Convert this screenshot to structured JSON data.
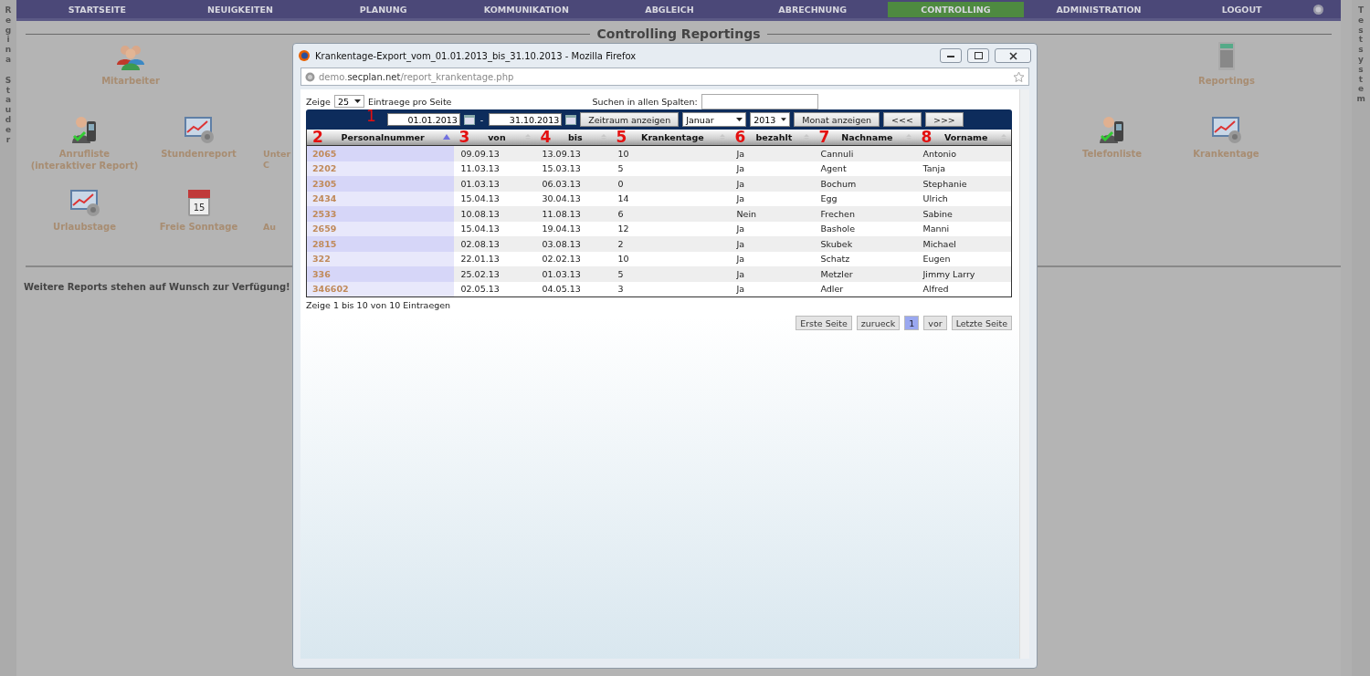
{
  "top_nav": {
    "items": [
      {
        "label": "STARTSEITE",
        "selected": false
      },
      {
        "label": "NEUIGKEITEN",
        "selected": false
      },
      {
        "label": "PLANUNG",
        "selected": false
      },
      {
        "label": "KOMMUNIKATION",
        "selected": false
      },
      {
        "label": "ABGLEICH",
        "selected": false
      },
      {
        "label": "ABRECHNUNG",
        "selected": false
      },
      {
        "label": "CONTROLLING",
        "selected": true
      },
      {
        "label": "ADMINISTRATION",
        "selected": false
      },
      {
        "label": "LOGOUT",
        "selected": false
      }
    ]
  },
  "user_name_lines": [
    "Regina",
    "Stauder"
  ],
  "system_label": "Testsystem",
  "page_title": "Controlling Reportings",
  "tile_rows": [
    [
      {
        "kind": "people",
        "label": "Mitarbeiter"
      },
      {
        "kind": "none"
      },
      {
        "kind": "none"
      },
      {
        "kind": "none"
      },
      {
        "kind": "none"
      },
      {
        "kind": "calculator",
        "label": "Reportings"
      }
    ],
    [
      {
        "kind": "phone",
        "label": "Anrufliste\n(interaktiver Report)"
      },
      {
        "kind": "chart",
        "label": "Stundenreport"
      },
      {
        "kind": "partial",
        "label": "Unter\nC"
      },
      {
        "kind": "none"
      },
      {
        "kind": "none"
      },
      {
        "kind": "none"
      },
      {
        "kind": "none"
      },
      {
        "kind": "none"
      },
      {
        "kind": "none"
      },
      {
        "kind": "phone",
        "label": "Telefonliste"
      },
      {
        "kind": "chart",
        "label": "Krankentage"
      }
    ],
    [
      {
        "kind": "chart",
        "label": "Urlaubstage"
      },
      {
        "kind": "calendar",
        "label": "Freie Sonntage",
        "icon_text": "15"
      },
      {
        "kind": "partial",
        "label": "Au"
      }
    ]
  ],
  "footer_note": "Weitere Reports stehen auf Wunsch zur Verfügung!",
  "popup": {
    "title": "Krankentage-Export_vom_01.01.2013_bis_31.10.2013 - Mozilla Firefox",
    "url": "demo.**secplan.net**/report_krankentage.php",
    "length_label_before": "Zeige",
    "length_value": "25",
    "length_label_after": "Eintraege pro Seite",
    "search_label": "Suchen in allen Spalten:",
    "toolbar": {
      "marker": "1",
      "date_from": "01.01.2013",
      "separator": "-",
      "date_to": "31.10.2013",
      "range_button": "Zeitraum anzeigen",
      "month": "Januar",
      "year": "2013",
      "month_button": "Monat anzeigen",
      "prev_button": "<<<",
      "next_button": ">>>"
    },
    "columns": [
      {
        "marker": "2",
        "label": "Personalnummer",
        "sorted": true
      },
      {
        "marker": "3",
        "label": "von",
        "sorted": false
      },
      {
        "marker": "4",
        "label": "bis",
        "sorted": false
      },
      {
        "marker": "5",
        "label": "Krankentage",
        "sorted": false
      },
      {
        "marker": "6",
        "label": "bezahlt",
        "sorted": false
      },
      {
        "marker": "7",
        "label": "Nachname",
        "sorted": false
      },
      {
        "marker": "8",
        "label": "Vorname",
        "sorted": false
      }
    ],
    "rows": [
      [
        "2065",
        "09.09.13",
        "13.09.13",
        "10",
        "Ja",
        "Cannuli",
        "Antonio"
      ],
      [
        "2202",
        "11.03.13",
        "15.03.13",
        "5",
        "Ja",
        "Agent",
        "Tanja"
      ],
      [
        "2305",
        "01.03.13",
        "06.03.13",
        "0",
        "Ja",
        "Bochum",
        "Stephanie"
      ],
      [
        "2434",
        "15.04.13",
        "30.04.13",
        "14",
        "Ja",
        "Egg",
        "Ulrich"
      ],
      [
        "2533",
        "10.08.13",
        "11.08.13",
        "6",
        "Nein",
        "Frechen",
        "Sabine"
      ],
      [
        "2659",
        "15.04.13",
        "19.04.13",
        "12",
        "Ja",
        "Bashole",
        "Manni"
      ],
      [
        "2815",
        "02.08.13",
        "03.08.13",
        "2",
        "Ja",
        "Skubek",
        "Michael"
      ],
      [
        "322",
        "22.01.13",
        "02.02.13",
        "10",
        "Ja",
        "Schatz",
        "Eugen"
      ],
      [
        "336",
        "25.02.13",
        "01.03.13",
        "5",
        "Ja",
        "Metzler",
        "Jimmy Larry"
      ],
      [
        "346602",
        "02.05.13",
        "04.05.13",
        "3",
        "Ja",
        "Adler",
        "Alfred"
      ]
    ],
    "info": "Zeige 1 bis 10 von 10 Eintraegen",
    "pagination": [
      {
        "label": "Erste Seite",
        "selected": false
      },
      {
        "label": "zurueck",
        "selected": false
      },
      {
        "label": "1",
        "selected": true
      },
      {
        "label": "vor",
        "selected": false
      },
      {
        "label": "Letzte Seite",
        "selected": false
      }
    ]
  }
}
